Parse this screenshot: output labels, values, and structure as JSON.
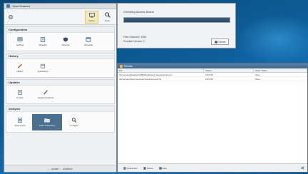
{
  "main_window": {
    "title": "Virus Scanner",
    "toolbar": {
      "settings_icon": "gear-icon",
      "buttons": [
        {
          "label": "Status",
          "icon": "monitor-icon"
        },
        {
          "label": "Scan",
          "icon": "magnifier-icon"
        }
      ]
    },
    "sections": [
      {
        "title": "Configuration",
        "items": [
          {
            "label": "Settings"
          },
          {
            "label": "Whitelist"
          },
          {
            "label": "Network"
          },
          {
            "label": "Schedule"
          }
        ]
      },
      {
        "title": "History",
        "items": [
          {
            "label": "History"
          },
          {
            "label": "Quarantine"
          }
        ]
      },
      {
        "title": "Updates",
        "items": [
          {
            "label": "Update"
          },
          {
            "label": "Update Assistant"
          }
        ]
      },
      {
        "title": "Analysis",
        "items": [
          {
            "label": "Scan a File"
          },
          {
            "label": "Scan a Directory"
          },
          {
            "label": "Analysis"
          }
        ]
      }
    ],
    "status_bar": "← update → available"
  },
  "progress_dialog": {
    "message": "Checking Access Scans",
    "progress": 1.0,
    "files_scanned": "Files Scanned: 1086",
    "viruses_found": "Possible Viruses: 2",
    "cancel_label": "Cancel"
  },
  "results_window": {
    "title": "Results",
    "columns": [
      "File",
      "Status",
      "Action Taken"
    ],
    "rows": [
      {
        "file": "/home/user/Desktop/c3f8d2a/infected_sample/eicar.com",
        "status": "FOUND",
        "action": "None"
      },
      {
        "file": "/home/user/Documents/archive/test-eicar.zip",
        "status": "FOUND",
        "action": "None"
      }
    ],
    "footer_buttons": [
      {
        "label": "Quarantine"
      },
      {
        "label": "Delete"
      },
      {
        "label": "Save"
      }
    ]
  }
}
